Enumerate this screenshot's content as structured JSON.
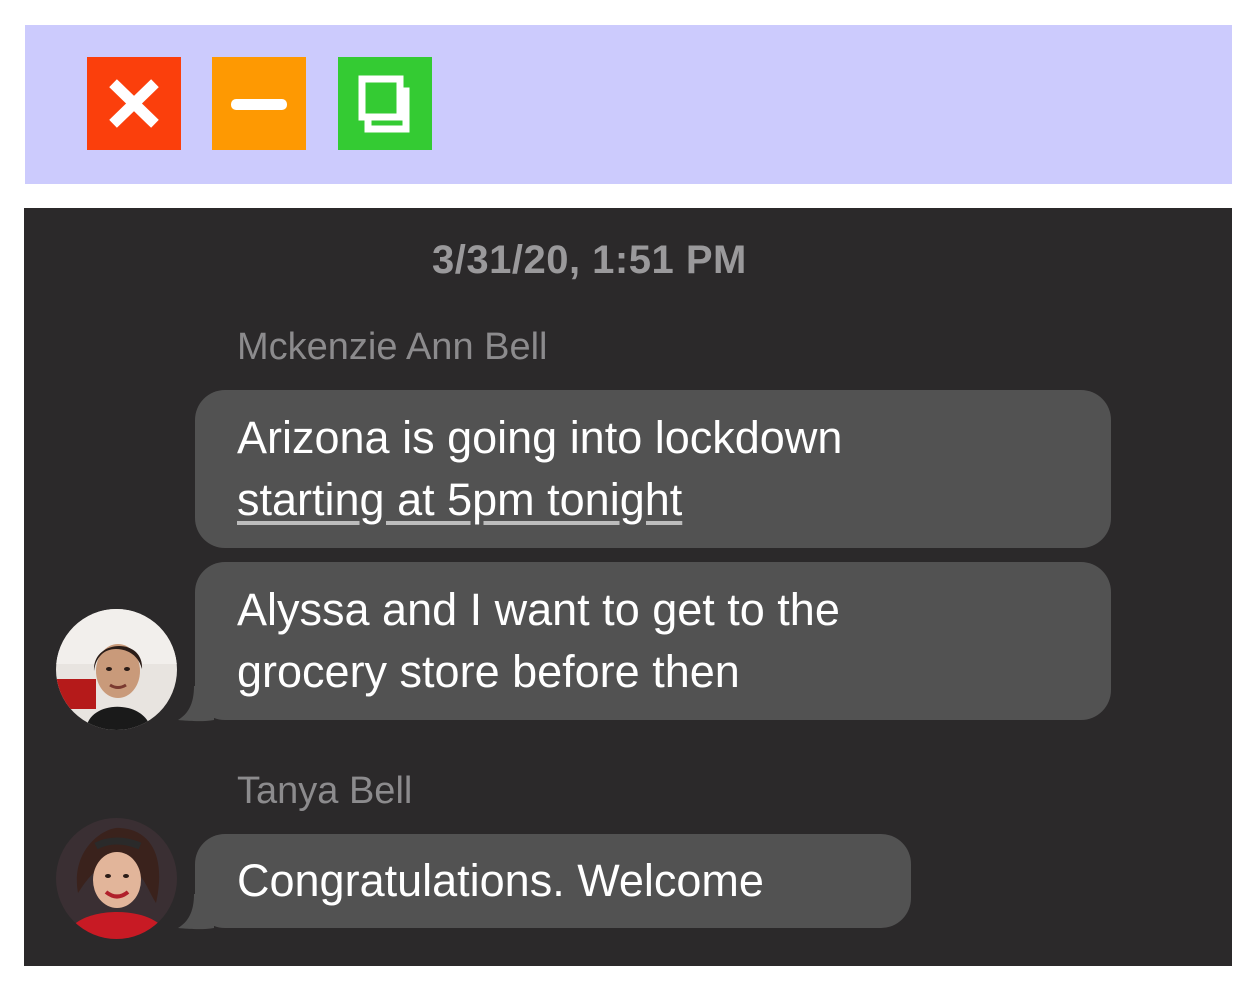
{
  "window_controls": {
    "close_icon": "close-icon",
    "minimize_icon": "minimize-icon",
    "maximize_icon": "maximize-icon",
    "colors": {
      "titlebar": "#cccbfd",
      "close": "#fb3f0c",
      "minimize": "#fe9902",
      "maximize": "#34cb33"
    }
  },
  "chat": {
    "background": "#2b292a",
    "timestamp": "3/31/20, 1:51 PM",
    "groups": [
      {
        "sender": "Mckenzie Ann Bell",
        "avatar_icon": "avatar-photo",
        "messages": [
          {
            "line1": "Arizona is going into lockdown",
            "line2_link": "starting at 5pm tonight"
          },
          {
            "line1": "Alyssa and I want to get to the",
            "line2": "grocery store before then"
          }
        ]
      },
      {
        "sender": "Tanya Bell",
        "avatar_icon": "avatar-photo",
        "messages": [
          {
            "line1": "Congratulations. Welcome"
          }
        ]
      }
    ]
  }
}
